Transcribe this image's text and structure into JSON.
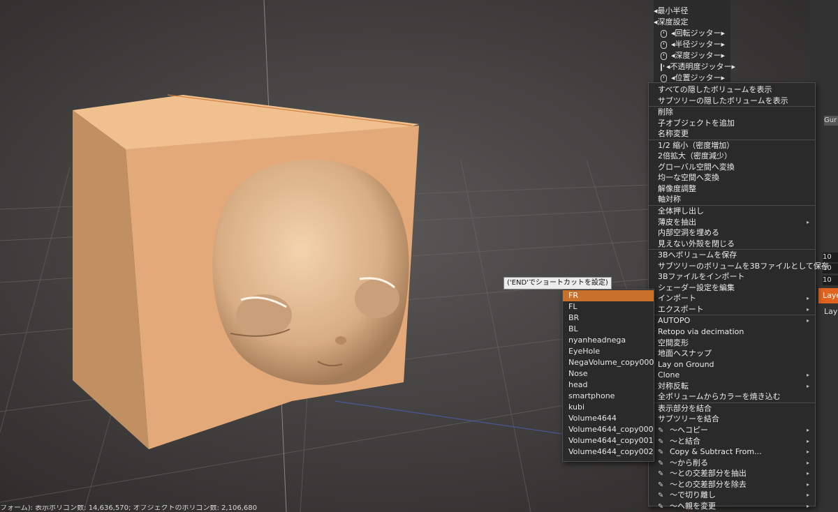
{
  "params": [
    "最小半径",
    "深度設定"
  ],
  "jitter_params": [
    "回転ジッター",
    "半径ジッター",
    "深度ジッター",
    "不透明度ジッター",
    "位置ジッター"
  ],
  "context_menu": [
    {
      "label": "すべての隠したボリュームを表示"
    },
    {
      "label": "サブツリーの隠したボリュームを表示"
    },
    {
      "label": "削除",
      "sep": true
    },
    {
      "label": "子オブジェクトを追加"
    },
    {
      "label": "名称変更"
    },
    {
      "label": "1/2 縮小（密度増加）",
      "sep": true
    },
    {
      "label": "2倍拡大（密度減少）"
    },
    {
      "label": "グローバル空間へ変換"
    },
    {
      "label": "均一な空間へ変換"
    },
    {
      "label": "解像度調整"
    },
    {
      "label": "軸対称"
    },
    {
      "label": "全体押し出し",
      "sep": true
    },
    {
      "label": "薄皮を抽出",
      "arrow": true
    },
    {
      "label": "内部空洞を埋める"
    },
    {
      "label": "見えない外殻を閉じる"
    },
    {
      "label": "3Bへボリュームを保存",
      "sep": true
    },
    {
      "label": "サブツリーのボリュームを3Bファイルとして保存"
    },
    {
      "label": "3Bファイルをインポート"
    },
    {
      "label": "シェーダー設定を編集"
    },
    {
      "label": "インポート",
      "arrow": true
    },
    {
      "label": "エクスポート",
      "arrow": true
    },
    {
      "label": "AUTOPO",
      "sep": true,
      "arrow": true
    },
    {
      "label": "Retopo via decimation"
    },
    {
      "label": "空間変形"
    },
    {
      "label": "地面へスナップ"
    },
    {
      "label": "Lay on Ground"
    },
    {
      "label": "Clone",
      "arrow": true
    },
    {
      "label": "対称反転",
      "arrow": true
    },
    {
      "label": "全ボリュームからカラーを焼き込む"
    },
    {
      "label": "表示部分を結合",
      "sep": true
    },
    {
      "label": "サブツリーを結合"
    },
    {
      "label": "〜へコピー",
      "pen": true,
      "arrow": true
    },
    {
      "label": "〜と結合",
      "pen": true,
      "arrow": true
    },
    {
      "label": "Copy & Subtract From...",
      "pen": true,
      "arrow": true
    },
    {
      "label": "〜から削る",
      "pen": true,
      "arrow": true
    },
    {
      "label": "〜との交差部分を抽出",
      "pen": true,
      "arrow": true
    },
    {
      "label": "〜との交差部分を除去",
      "pen": true,
      "arrow": true
    },
    {
      "label": "〜で切り離し",
      "pen": true,
      "arrow": true
    },
    {
      "label": "〜へ親を変更",
      "pen": true,
      "arrow": true
    }
  ],
  "submenu": [
    "FR",
    "FL",
    "BR",
    "BL",
    "nyanheadnega",
    "EyeHole",
    "NegaVolume_copy000",
    "Nose",
    "head",
    "smartphone",
    "kubi",
    "Volume4644",
    "Volume4644_copy000",
    "Volume4644_copy001",
    "Volume4644_copy002"
  ],
  "submenu_selected": 0,
  "tooltip": "('END'でショートカットを設定)",
  "status": "フォーム):  表示ポリゴン数: 14,636,570; オブジェクトのポリゴン数: 2,106,680",
  "right_values": [
    "10",
    "10",
    "10"
  ],
  "right_labels": [
    "Gur",
    "Laye",
    "Laye"
  ],
  "colors": {
    "accent": "#c8712b",
    "cube": "#e7b07e",
    "background": "#3b3a39",
    "menu_bg": "#2a2a2a"
  }
}
